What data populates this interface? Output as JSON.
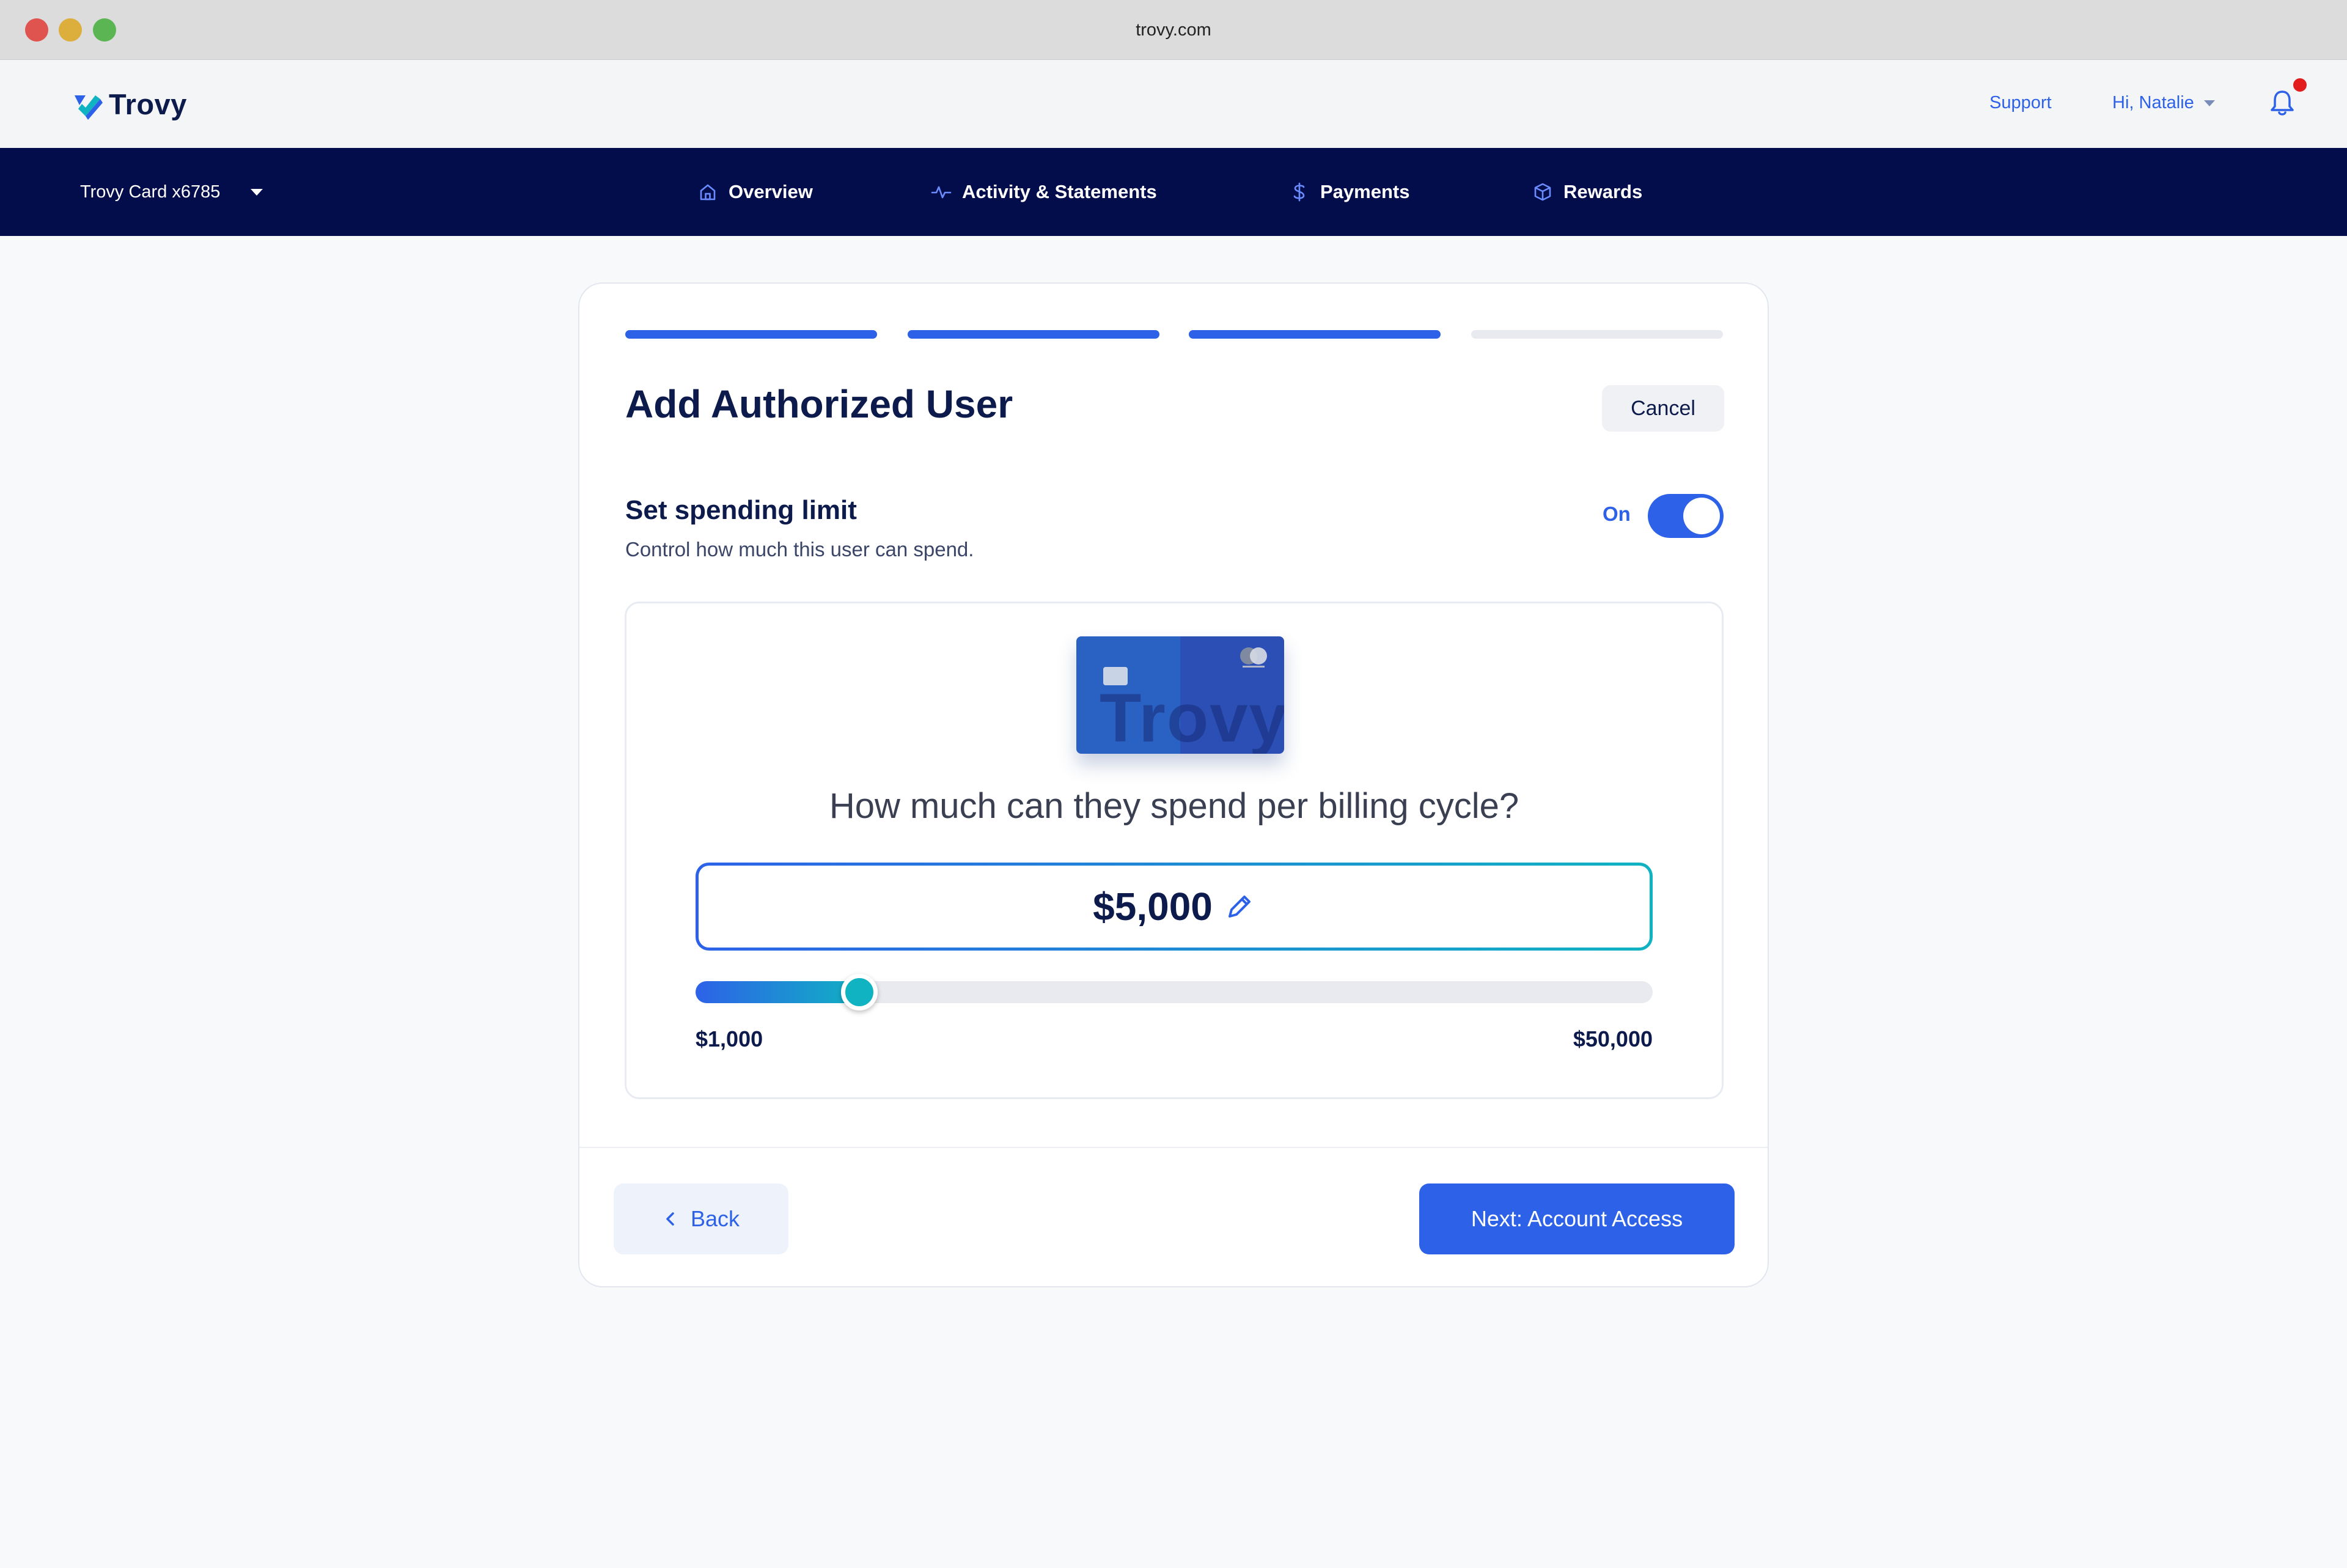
{
  "browser": {
    "url": "trovy.com"
  },
  "header": {
    "brand": "Trovy",
    "support_label": "Support",
    "user_greeting": "Hi, Natalie"
  },
  "nav": {
    "card_selector": "Trovy Card x6785",
    "items": [
      {
        "label": "Overview",
        "icon": "home-icon"
      },
      {
        "label": "Activity & Statements",
        "icon": "activity-icon"
      },
      {
        "label": "Payments",
        "icon": "dollar-icon"
      },
      {
        "label": "Rewards",
        "icon": "box-icon"
      }
    ]
  },
  "wizard": {
    "steps_total": 4,
    "current_step": 3,
    "title": "Add Authorized User",
    "cancel_label": "Cancel",
    "section_title": "Set spending limit",
    "section_subtitle": "Control how much this user can spend.",
    "toggle_label": "On",
    "toggle_on": true,
    "card_brand_text": "Trovy",
    "question": "How much can they spend per billing cycle?",
    "amount": "$5,000",
    "slider": {
      "min_label": "$1,000",
      "max_label": "$50,000",
      "min": 1000,
      "max": 50000,
      "value": 5000
    },
    "back_label": "Back",
    "next_label": "Next: Account Access"
  },
  "colors": {
    "accent": "#2d62e8",
    "nav_bg": "#040d4b",
    "teal": "#10b3c2",
    "notification": "#e31d1d"
  }
}
